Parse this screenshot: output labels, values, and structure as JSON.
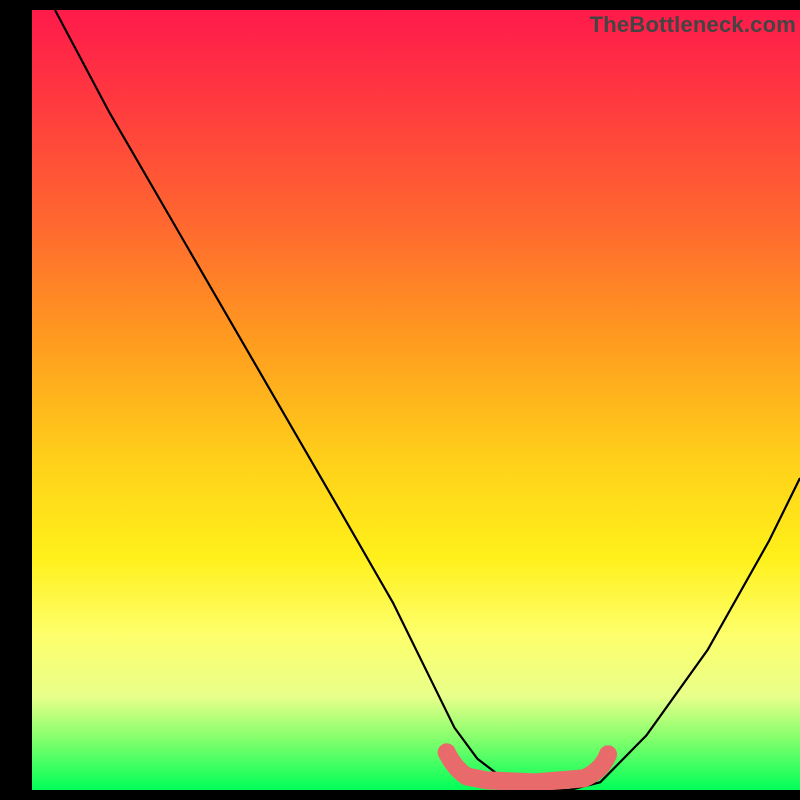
{
  "watermark": "TheBottleneck.com",
  "colors": {
    "gradient_top": "#ff1a4b",
    "gradient_bottom": "#00ff58",
    "curve": "#000000",
    "flat_zone": "#e86a6a",
    "background_letterbox": "#000000"
  },
  "chart_data": {
    "type": "line",
    "title": "",
    "xlabel": "",
    "ylabel": "",
    "xlim": [
      0,
      100
    ],
    "ylim": [
      0,
      100
    ],
    "note": "No axes or tick labels present; values are relative estimates read from curve shape.",
    "series": [
      {
        "name": "bottleneck-curve",
        "color": "#000000",
        "x": [
          3,
          10,
          20,
          30,
          40,
          47,
          52,
          55,
          58,
          62,
          66,
          70,
          74,
          80,
          88,
          96,
          100
        ],
        "values": [
          100,
          87,
          70,
          53,
          36,
          24,
          14,
          8,
          4,
          1,
          0,
          0,
          1,
          7,
          18,
          32,
          40
        ]
      }
    ],
    "flat_zone": {
      "description": "Thick pink overlay near the curve minimum indicating optimal range",
      "color": "#e86a6a",
      "x_start": 54,
      "x_end": 75,
      "y_approx": 2
    }
  }
}
